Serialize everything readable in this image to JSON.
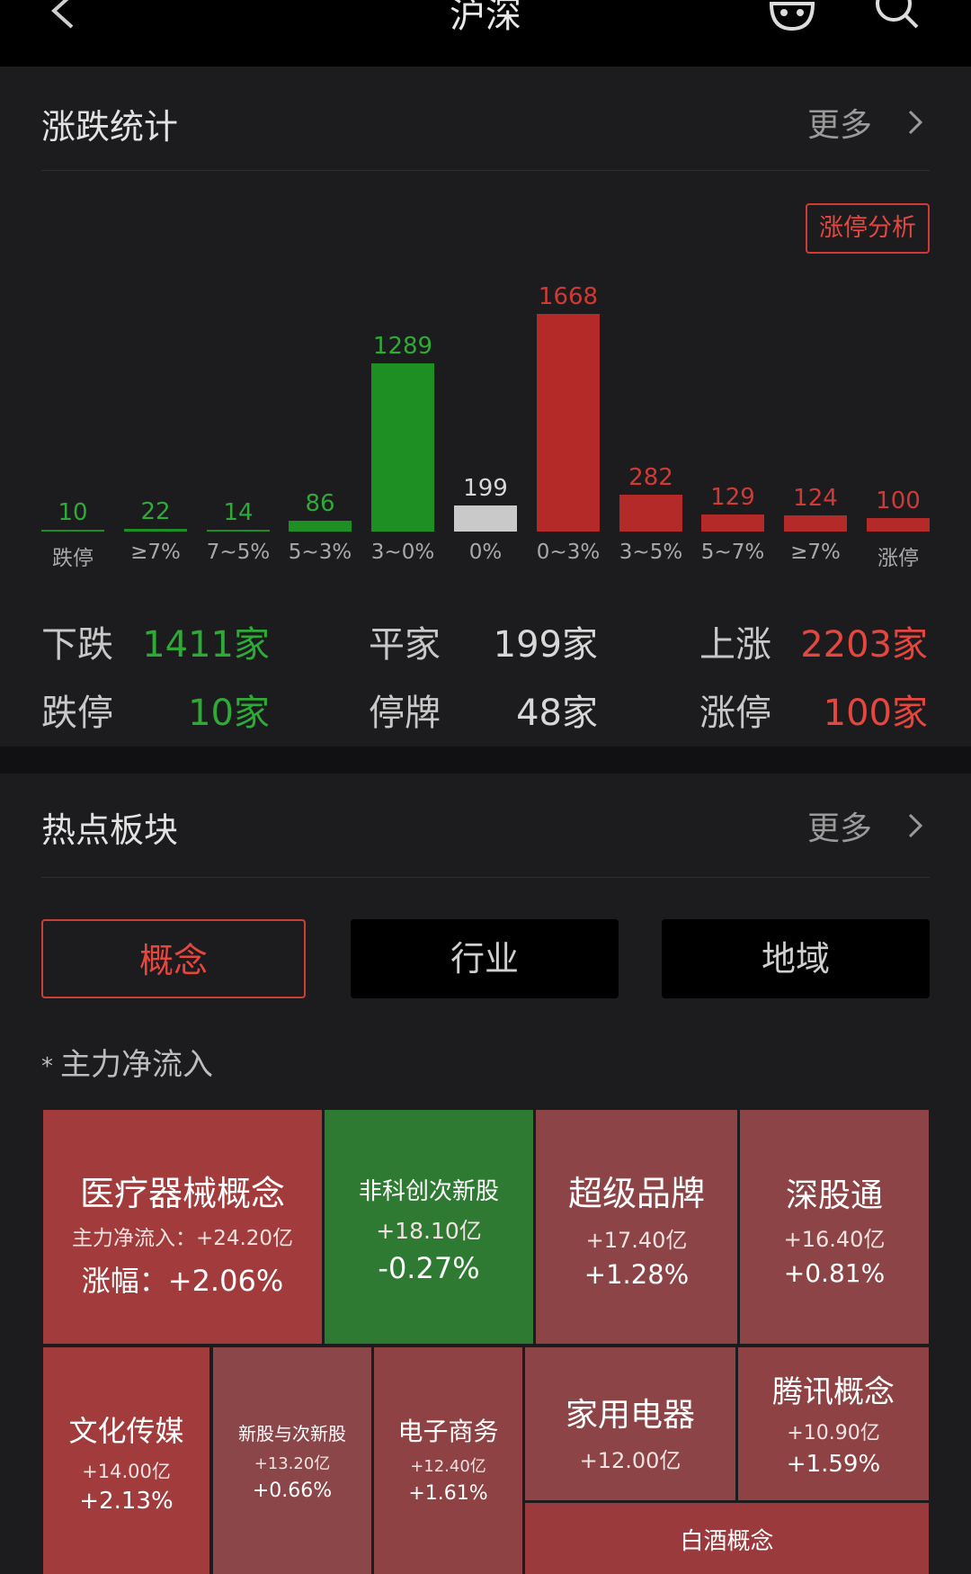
{
  "header": {
    "title": "沪深"
  },
  "stats": {
    "title": "涨跌统计",
    "more": "更多",
    "badge": "涨停分析",
    "rows": [
      {
        "down_label": "下跌",
        "down_value": "1411家",
        "flat_label": "平家",
        "flat_value": "199家",
        "up_label": "上涨",
        "up_value": "2203家"
      },
      {
        "down_label": "跌停",
        "down_value": "10家",
        "flat_label": "停牌",
        "flat_value": "48家",
        "up_label": "涨停",
        "up_value": "100家"
      }
    ]
  },
  "chart_data": {
    "type": "bar",
    "categories": [
      "跌停",
      "≥7%",
      "7~5%",
      "5~3%",
      "3~0%",
      "0%",
      "0~3%",
      "3~5%",
      "5~7%",
      "≥7%",
      "涨停"
    ],
    "values": [
      10,
      22,
      14,
      86,
      1289,
      199,
      1668,
      282,
      129,
      124,
      100
    ],
    "value_labels": [
      "10",
      "22",
      "14",
      "86",
      "1289",
      "199",
      "1668",
      "282",
      "129",
      "124",
      "100"
    ],
    "colors": [
      "#1e8f22",
      "#1e8f22",
      "#1e8f22",
      "#1e8f22",
      "#1e8f22",
      "#c9c9c9",
      "#b42a28",
      "#b42a28",
      "#b42a28",
      "#b42a28",
      "#b42a28"
    ],
    "label_colors": [
      "#2eaa36",
      "#2eaa36",
      "#2eaa36",
      "#2eaa36",
      "#2eaa36",
      "#d8d8d8",
      "#d03a35",
      "#d03a35",
      "#d03a35",
      "#d03a35",
      "#d03a35"
    ],
    "ylim": [
      0,
      1668
    ]
  },
  "colors": {
    "up": "#e5473f",
    "down": "#2eaa36",
    "flat": "#d8d8d8"
  },
  "hot": {
    "title": "热点板块",
    "more": "更多",
    "tabs": [
      "概念",
      "行业",
      "地域"
    ],
    "active_tab": "概念",
    "sort_label": "主力净流入",
    "sort_mark": "*",
    "tiles": [
      {
        "name": "医疗器械概念",
        "flow": "主力净流入：+24.20亿",
        "change": "涨幅：+2.06%",
        "bg": "#a23c3c"
      },
      {
        "name": "非科创次新股",
        "flow": "+18.10亿",
        "change": "-0.27%",
        "bg": "#2f7a32"
      },
      {
        "name": "超级品牌",
        "flow": "+17.40亿",
        "change": "+1.28%",
        "bg": "#8c4446"
      },
      {
        "name": "深股通",
        "flow": "+16.40亿",
        "change": "+0.81%",
        "bg": "#8c4446"
      },
      {
        "name": "文化传媒",
        "flow": "+14.00亿",
        "change": "+2.13%",
        "bg": "#a23c3c"
      },
      {
        "name": "新股与次新股",
        "flow": "+13.20亿",
        "change": "+0.66%",
        "bg": "#8a4648"
      },
      {
        "name": "电子商务",
        "flow": "+12.40亿",
        "change": "+1.61%",
        "bg": "#8f4244"
      },
      {
        "name": "家用电器",
        "flow": "+12.00亿",
        "change": "",
        "bg": "#8c4446"
      },
      {
        "name": "腾讯概念",
        "flow": "+10.90亿",
        "change": "+1.59%",
        "bg": "#8f4244"
      },
      {
        "name": "白酒概念",
        "flow": "",
        "change": "",
        "bg": "#9a3a3c"
      }
    ]
  }
}
